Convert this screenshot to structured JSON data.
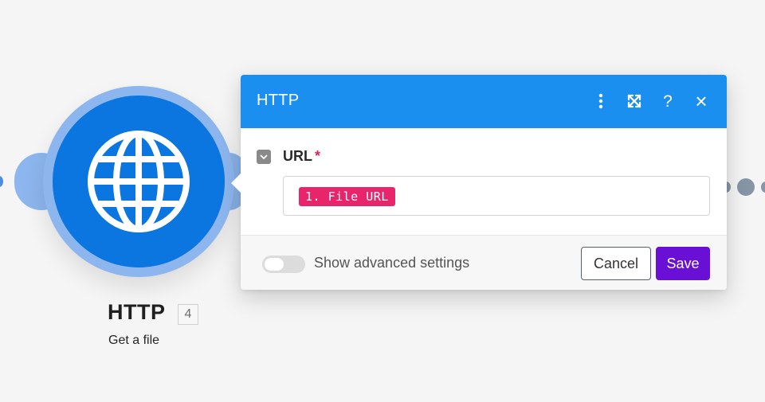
{
  "node": {
    "title": "HTTP",
    "badge": "4",
    "subtitle": "Get a file"
  },
  "dialog": {
    "title": "HTTP",
    "header_icons": {
      "more": "more-vertical-icon",
      "expand": "expand-icon",
      "help": "?",
      "close": "×"
    },
    "field": {
      "label": "URL",
      "required_mark": "*",
      "value_pill": "1. File URL"
    },
    "footer": {
      "toggle_label": "Show advanced settings",
      "cancel_label": "Cancel",
      "save_label": "Save"
    }
  },
  "colors": {
    "header_blue": "#1a8ff0",
    "node_blue": "#0b76e0",
    "pill_pink": "#e8246a",
    "save_purple": "#6a0fd6",
    "required_red": "#e02457"
  }
}
